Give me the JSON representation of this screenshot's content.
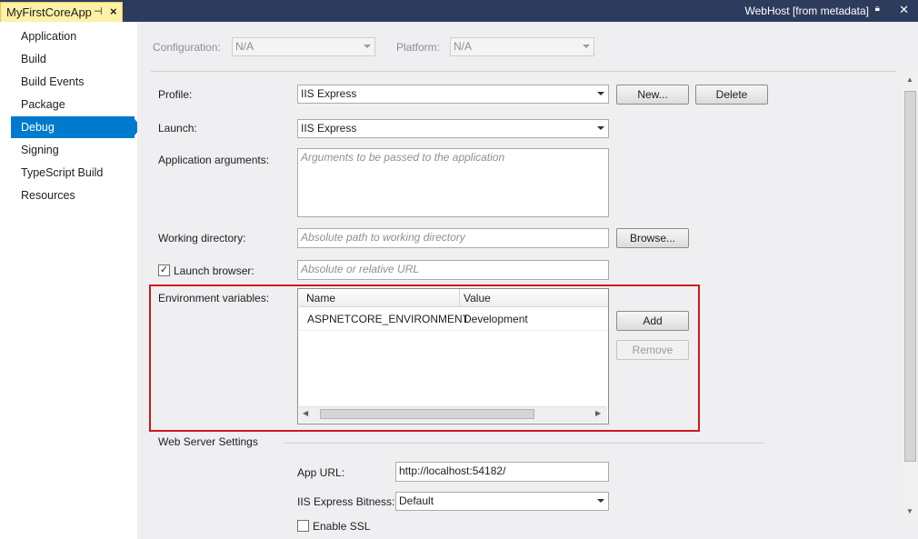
{
  "titlebar": {
    "doc_tab": "MyFirstCoreApp",
    "pin_icon": "pin-icon",
    "close_icon": "close-icon",
    "right_title": "WebHost [from metadata]"
  },
  "nav": {
    "items": [
      {
        "label": "Application"
      },
      {
        "label": "Build"
      },
      {
        "label": "Build Events"
      },
      {
        "label": "Package"
      },
      {
        "label": "Debug"
      },
      {
        "label": "Signing"
      },
      {
        "label": "TypeScript Build"
      },
      {
        "label": "Resources"
      }
    ],
    "selected": "Debug"
  },
  "config": {
    "configuration_label": "Configuration:",
    "configuration_value": "N/A",
    "platform_label": "Platform:",
    "platform_value": "N/A"
  },
  "debug": {
    "profile_label": "Profile:",
    "profile_value": "IIS Express",
    "new_button": "New...",
    "delete_button": "Delete",
    "launch_label": "Launch:",
    "launch_value": "IIS Express",
    "app_args_label": "Application arguments:",
    "app_args_placeholder": "Arguments to be passed to the application",
    "workdir_label": "Working directory:",
    "workdir_placeholder": "Absolute path to working directory",
    "browse_button": "Browse...",
    "launch_browser_label": "Launch browser:",
    "launch_browser_checked": true,
    "launch_browser_placeholder": "Absolute or relative URL",
    "env_label": "Environment variables:",
    "env_columns": [
      "Name",
      "Value"
    ],
    "env_rows": [
      {
        "name": "ASPNETCORE_ENVIRONMENT",
        "value": "Development"
      }
    ],
    "add_button": "Add",
    "remove_button": "Remove",
    "web_server_label": "Web Server Settings",
    "app_url_label": "App URL:",
    "app_url_value": "http://localhost:54182/",
    "bitness_label": "IIS Express Bitness:",
    "bitness_value": "Default",
    "enable_ssl_label": "Enable SSL"
  },
  "colors": {
    "titlebar": "#2d3c5c",
    "doc_tab": "#fff1a6",
    "selection": "#007acc",
    "highlight_box": "#d0171e",
    "content_bg": "#efeff2"
  }
}
